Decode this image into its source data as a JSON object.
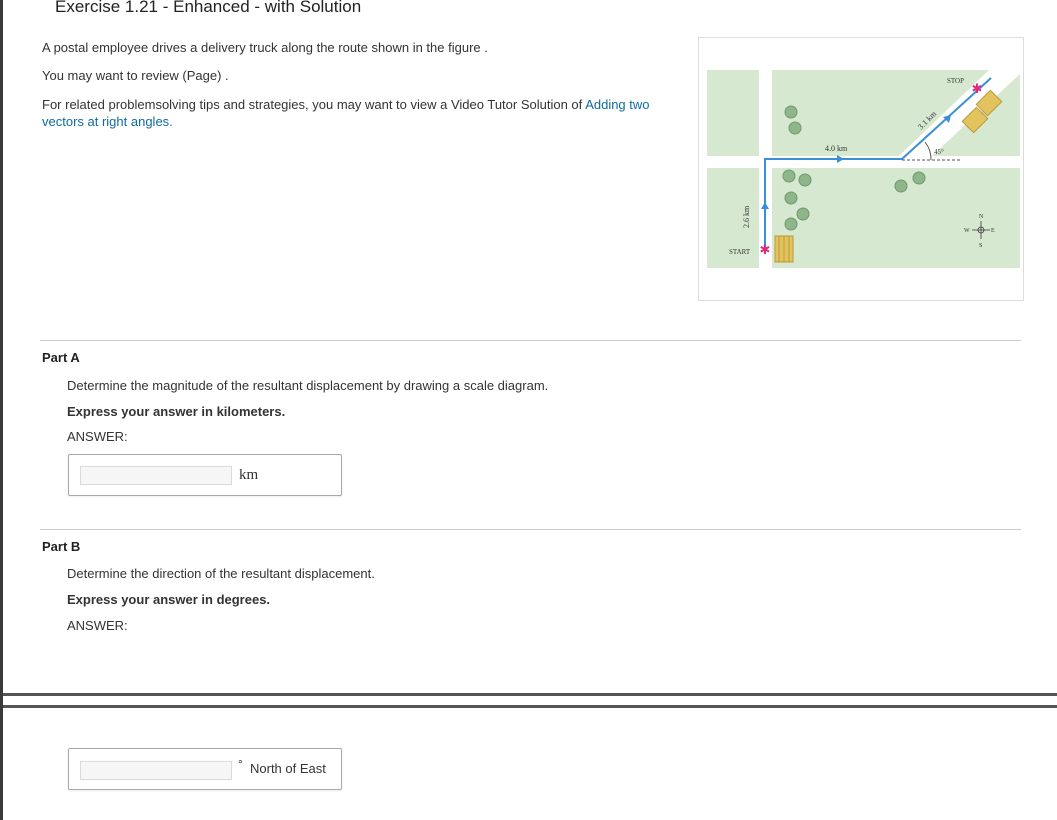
{
  "title": "Exercise 1.21 - Enhanced - with Solution",
  "intro": {
    "line1": "A postal employee drives a delivery truck along the route shown in the figure .",
    "line2": "You may want to review (Page) .",
    "line3_prefix": "For related problemsolving tips and strategies, you may want to view a Video Tutor Solution of",
    "line3_link1": "Adding two",
    "line3_link2": "vectors at right angles."
  },
  "figure": {
    "stop_label": "STOP",
    "start_label": "START",
    "leg1_label": "2.6 km",
    "leg2_label": "4.0 km",
    "leg3_label": "3.1 km",
    "angle_label": "45°",
    "compass": {
      "n": "N",
      "s": "S",
      "e": "E",
      "w": "W"
    },
    "colors": {
      "grass": "#d7e8d0",
      "route": "#3a8fd8",
      "stop_star": "#e0287a",
      "house": "#e3c35e",
      "tree": "#8fb58a"
    }
  },
  "part_a": {
    "title": "Part A",
    "question": "Determine the magnitude of the resultant displacement by drawing a scale diagram.",
    "instruction": "Express your answer in kilometers.",
    "answer_label": "ANSWER:",
    "input_value": "",
    "unit": "km"
  },
  "part_b": {
    "title": "Part B",
    "question": "Determine the direction of the resultant displacement.",
    "instruction": "Express your answer in degrees.",
    "answer_label": "ANSWER:",
    "input_value": "",
    "unit_symbol": "°",
    "unit": "North of East"
  }
}
